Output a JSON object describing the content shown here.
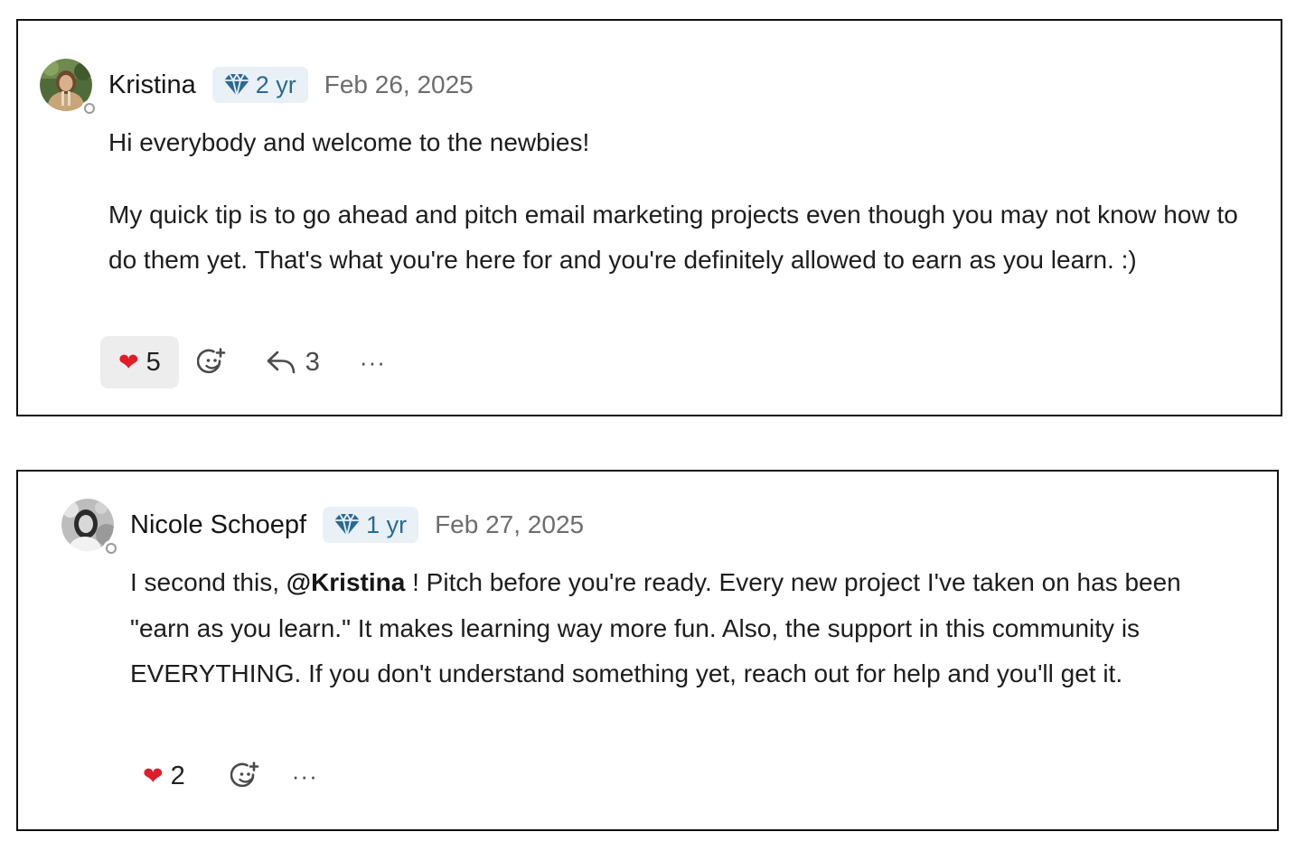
{
  "comments": [
    {
      "author": "Kristina",
      "badge": {
        "icon": "diamond-icon",
        "label": "2 yr"
      },
      "date": "Feb 26, 2025",
      "paragraphs": [
        "Hi everybody and welcome to the newbies!",
        "My quick tip is to go ahead and pitch email marketing projects even though you may not know how to do them yet. That's what you're here for and you're definitely allowed to earn as you learn. :)"
      ],
      "reaction": {
        "icon": "heart-icon",
        "count": "5",
        "active": true
      },
      "replies": {
        "icon": "reply-arrow-icon",
        "count": "3"
      },
      "more_label": "···"
    },
    {
      "author": "Nicole Schoepf",
      "badge": {
        "icon": "diamond-icon",
        "label": "1 yr"
      },
      "date": "Feb 27, 2025",
      "text_before_mention": "I second this, ",
      "mention": "@Kristina",
      "text_after_mention": " ! Pitch before you're ready. Every new project I've taken on has been \"earn as you learn.\" It makes learning way more fun. Also, the support in this community is EVERYTHING. If you don't understand something yet, reach out for help and you'll get it.",
      "reaction": {
        "icon": "heart-icon",
        "count": "2",
        "active": false
      },
      "more_label": "···"
    }
  ],
  "colors": {
    "badge_bg": "#e9f1f6",
    "badge_text": "#2a6a92",
    "heart": "#e11d2a",
    "date": "#6d6d6d"
  }
}
